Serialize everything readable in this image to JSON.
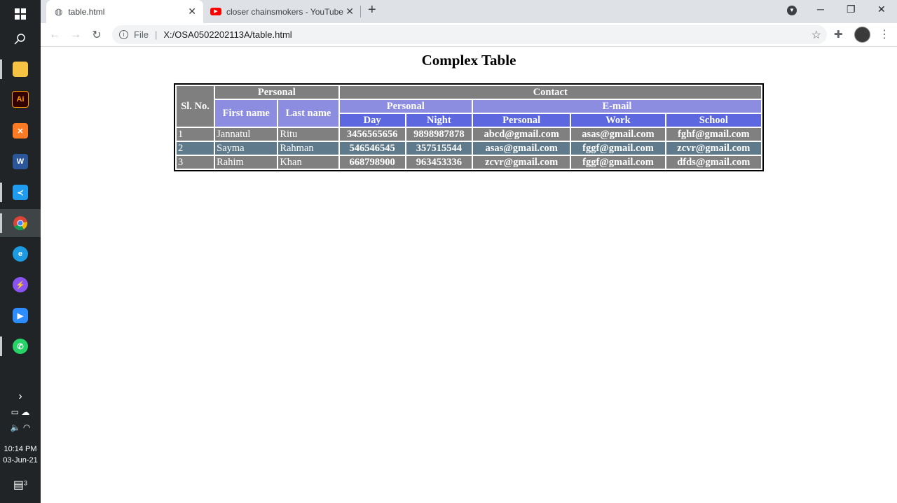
{
  "browser": {
    "tabs": [
      {
        "title": "table.html"
      },
      {
        "title": "closer chainsmokers - YouTube"
      }
    ],
    "new_tab": "+",
    "address": {
      "scheme_label": "File",
      "path": "X:/OSA0502202113A/table.html"
    }
  },
  "taskbar": {
    "time": "10:14 PM",
    "date": "03-Jun-21",
    "notifications": "3",
    "apps": [
      "file-explorer",
      "illustrator",
      "xampp",
      "word",
      "vscode",
      "chrome",
      "edge",
      "messenger",
      "zoom",
      "whatsapp"
    ]
  },
  "page": {
    "title": "Complex Table",
    "headers": {
      "sl": "Sl. No.",
      "personal": "Personal",
      "contact": "Contact",
      "first_name": "First name",
      "last_name": "Last name",
      "contact_personal": "Personal",
      "email": "E-mail",
      "day": "Day",
      "night": "Night",
      "email_personal": "Personal",
      "work": "Work",
      "school": "School"
    },
    "rows": [
      [
        "1",
        "Jannatul",
        "Ritu",
        "3456565656",
        "9898987878",
        "abcd@gmail.com",
        "asas@gmail.com",
        "fghf@gmail.com"
      ],
      [
        "2",
        "Sayma",
        "Rahman",
        "546546545",
        "357515544",
        "asas@gmail.com",
        "fggf@gmail.com",
        "zcvr@gmail.com"
      ],
      [
        "3",
        "Rahim",
        "Khan",
        "668798900",
        "963453336",
        "zcvr@gmail.com",
        "fggf@gmail.com",
        "dfds@gmail.com"
      ]
    ]
  }
}
